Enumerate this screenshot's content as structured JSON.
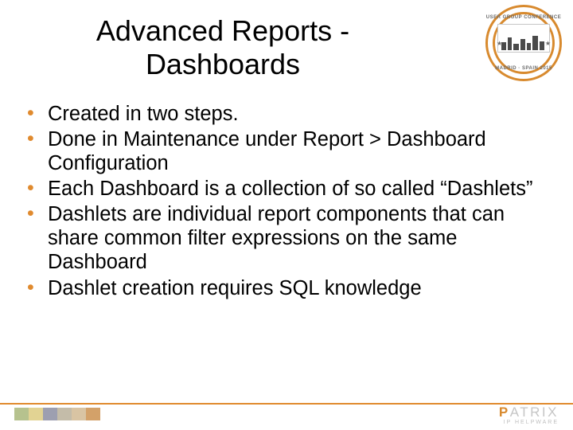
{
  "title_line1": "Advanced Reports -",
  "title_line2": "Dashboards",
  "badge": {
    "arc_top": "USER GROUP CONFERENCE",
    "arc_bottom": "MADRID · SPAIN 2015"
  },
  "bullets": [
    "Created in two steps.",
    "Done in Maintenance under Report > Dashboard Configuration",
    "Each Dashboard is a collection of so called “Dashlets”",
    "Dashlets are individual report components that can share common filter expressions on the same Dashboard",
    "Dashlet creation requires SQL knowledge"
  ],
  "footer": {
    "brand_accent": "P",
    "brand_rest": "ATRIX",
    "tagline": "IP HELPWARE"
  }
}
